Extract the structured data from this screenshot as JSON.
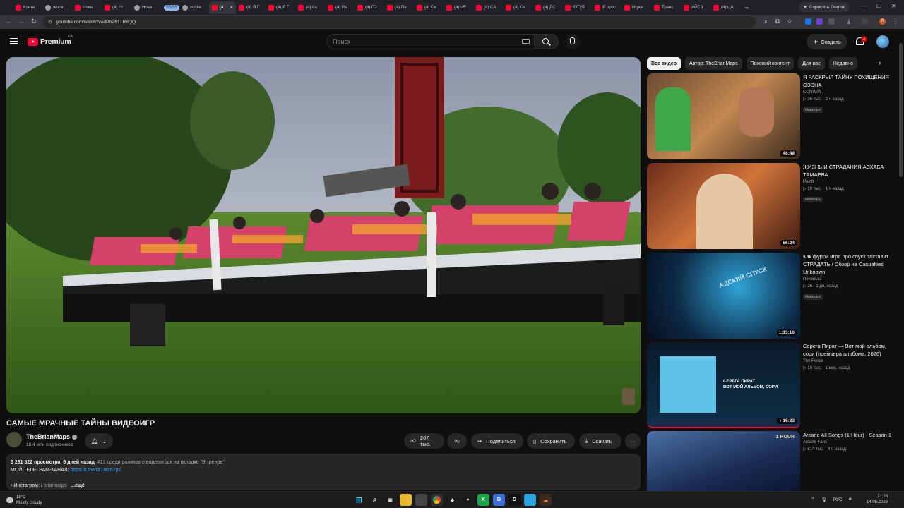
{
  "browser": {
    "tabs": [
      {
        "label": "Конте",
        "kind": "yt"
      },
      {
        "label": "яшся",
        "kind": "g"
      },
      {
        "label": "Нова",
        "kind": "yt"
      },
      {
        "label": "(4) Hi",
        "kind": "yt"
      },
      {
        "label": "Нова",
        "kind": "g"
      },
      {
        "label": "SSSS",
        "kind": "special"
      },
      {
        "label": "voidle",
        "kind": "g"
      },
      {
        "label": "(4",
        "kind": "active"
      },
      {
        "label": "(4) Я Г",
        "kind": "yt"
      },
      {
        "label": "(4) Я Г",
        "kind": "yt"
      },
      {
        "label": "(4) Ка",
        "kind": "yt"
      },
      {
        "label": "(4) Ра",
        "kind": "yt"
      },
      {
        "label": "(4) ГО",
        "kind": "yt"
      },
      {
        "label": "(4) Пе",
        "kind": "yt"
      },
      {
        "label": "(4) Се",
        "kind": "yt"
      },
      {
        "label": "(4) ЧЕ",
        "kind": "yt"
      },
      {
        "label": "(4) СА",
        "kind": "yt"
      },
      {
        "label": "(4) Се",
        "kind": "yt"
      },
      {
        "label": "(4) ДС",
        "kind": "yt"
      },
      {
        "label": "ЮТУБ",
        "kind": "yt"
      },
      {
        "label": "Я прос",
        "kind": "yt"
      },
      {
        "label": "Игрон",
        "kind": "yt"
      },
      {
        "label": "Транс",
        "kind": "yt"
      },
      {
        "label": "АЙСЗ",
        "kind": "yt"
      },
      {
        "label": "(4) ЦА",
        "kind": "yt"
      }
    ],
    "new_tab": "+",
    "gemini_label": "Спросить Gemini",
    "url": "youtube.com/watch?v=dPhP61TR8QQ",
    "ext_badge": "R"
  },
  "header": {
    "logo_text": "Premium",
    "country": "UA",
    "search_placeholder": "Поиск",
    "create_label": "Создать",
    "notif_count": "4"
  },
  "video": {
    "title": "САМЫЕ МРАЧНЫЕ ТАЙНЫ ВИДЕОИГР",
    "channel": "TheBrianMaps",
    "subscribers": "18,4 млн подписчиков",
    "likes": "267 тыс.",
    "share_label": "Поделиться",
    "save_label": "Сохранить",
    "download_label": "Скачать",
    "more": "···"
  },
  "description": {
    "views": "3 261 822 просмотра",
    "date": "6 дней назад",
    "tag": "#13 среди роликов о видеоиграх на вкладке \"В тренде\"",
    "line2_prefix": "МОЙ ТЕЛЕГРАМ-КАНАЛ: ",
    "telegram_link": "https://t.me/br1anm7ps",
    "line3_prefix": "• Инстаграм: ",
    "instagram": "/ brianmaps",
    "more_label": "...ещё"
  },
  "chips": [
    "Все видео",
    "Автор: TheBrianMaps",
    "Похожий контент",
    "Для вас",
    "Недавно"
  ],
  "recommendations": [
    {
      "title": "Я РАСКРЫЛ ТАЙНУ ПОХИЩЕНИЯ ОЗОНА",
      "channel": "CONWAY",
      "views": "36 тыс.",
      "age": "2 ч назад",
      "badge": "Новинка",
      "duration": "48:48"
    },
    {
      "title": "ЖИЗНЬ И СТРАДАНИЯ АСХАБА ТАМАЕВА",
      "channel": "Pointt",
      "views": "10 тыс.",
      "age": "1 ч назад",
      "badge": "Новинка",
      "duration": "56:24"
    },
    {
      "title": "Как фурри игра про спуск заставит СТРАДАТЬ / Обзор на Casualties Unknown",
      "channel": "Печенька",
      "views": "26",
      "age": "1 дн. назад",
      "badge": "Новинка",
      "duration": "1:13:16"
    },
    {
      "title": "Серега Пират — Вот мой альбом, сори (премьера альбома, 2026)",
      "channel": "The Fence",
      "views": "10 тыс.",
      "age": "1 мес. назад",
      "badge": "",
      "duration": "16:32"
    },
    {
      "title": "Arcane All Songs (1 Hour) - Season 1",
      "channel": "Arcane Fans",
      "views": "814 тыс.",
      "age": "4 г. назад",
      "badge": "",
      "duration": ""
    }
  ],
  "thumb_text": {
    "rec3_overlay": "АДСКИЙ СПУСК",
    "rec4_overlay_1": "СЕРЕГА ПИРАТ",
    "rec4_overlay_2": "ВОТ МОЙ АЛЬБОМ, СОРИ",
    "rec5_overlay": "1 HOUR"
  },
  "taskbar": {
    "temp": "18°C",
    "weather": "Mostly cloudy",
    "lang": "РУС",
    "time": "21:28",
    "date": "14.08.2026"
  },
  "colors": {
    "yt_red": "#ff0033",
    "bg": "#0f0f0f",
    "link": "#3ea6ff"
  }
}
